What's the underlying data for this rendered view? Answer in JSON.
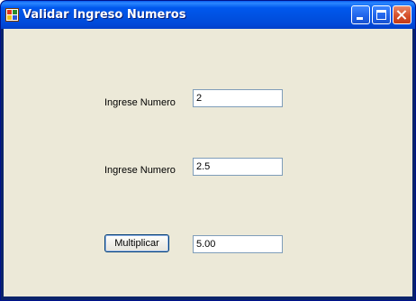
{
  "window": {
    "title": "Validar Ingreso Numeros"
  },
  "form": {
    "label1": "Ingrese Numero",
    "input1_value": "2",
    "label2": "Ingrese Numero",
    "input2_value": "2.5",
    "multiply_button_label": "Multiplicar",
    "result_value": "5.00"
  },
  "titlebar_buttons": {
    "minimize_icon": "minimize-icon",
    "maximize_icon": "maximize-icon",
    "close_icon": "close-icon"
  },
  "colors": {
    "titlebar": "#0054e3",
    "client_background": "#ece9d8",
    "close_button": "#d6502b"
  }
}
